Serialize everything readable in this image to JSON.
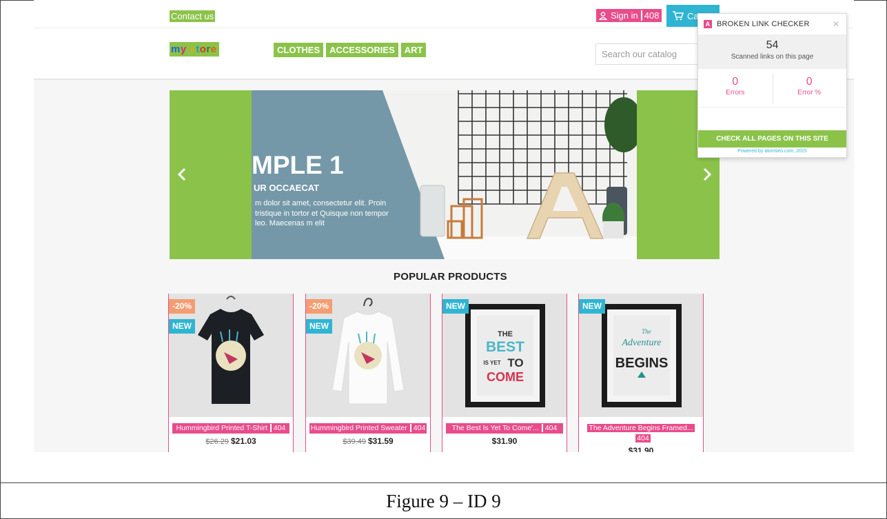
{
  "header": {
    "contact_label": "Contact us",
    "signin_label": "Sign in",
    "signin_badge": "408",
    "cart_label": "Cart",
    "logo_text": "my store",
    "nav": [
      "CLOTHES",
      "ACCESSORIES",
      "ART"
    ],
    "search_placeholder": "Search our catalog"
  },
  "slider": {
    "title": "MPLE 1",
    "subtitle": "UR OCCAECAT",
    "description": "m dolor sit amet, consectetur elit. Proin tristique in tortor et Quisque non tempor leo. Maecenas m elit",
    "prev_icon": "chevron-left-icon",
    "next_icon": "chevron-right-icon",
    "accent_color": "#8bc34a"
  },
  "section_title": "POPULAR PRODUCTS",
  "products": [
    {
      "name": "Hummingbird Printed T-Shirt",
      "badge": "404",
      "old_price": "$26.29",
      "price": "$21.03",
      "discount": "-20%",
      "flag": "NEW"
    },
    {
      "name": "Hummingbird Printed Sweater",
      "badge": "404",
      "old_price": "$39.49",
      "price": "$31.59",
      "discount": "-20%",
      "flag": "NEW"
    },
    {
      "name": "The Best Is Yet To Come'...",
      "badge": "404",
      "old_price": "",
      "price": "$31.90",
      "discount": "",
      "flag": "NEW"
    },
    {
      "name": "The Adventure Begins Framed...",
      "badge": "404",
      "old_price": "",
      "price": "$31.90",
      "discount": "",
      "flag": "NEW"
    }
  ],
  "broken_link_checker": {
    "title": "BROKEN LINK CHECKER",
    "logo_letter": "A",
    "scanned_count": "54",
    "scanned_label": "Scanned links on this page",
    "errors_value": "0",
    "errors_label": "Errors",
    "error_pct_value": "0",
    "error_pct_label": "Error %",
    "check_all_label": "CHECK ALL PAGES ON THIS SITE",
    "powered_by": "Powered by atomseo.com, 2015"
  },
  "poster_text": {
    "best_1": "THE",
    "best_2": "BEST",
    "best_3": "IS YET",
    "best_4": "TO",
    "best_5": "COME",
    "adv_1": "The",
    "adv_2": "Adventure",
    "adv_3": "BEGINS"
  },
  "caption": "Figure 9 – ID 9",
  "colors": {
    "brand_green": "#8bc34a",
    "link_error_pink": "#e84c8b",
    "cart_blue": "#2fb5d2",
    "discount_orange": "#f39d72"
  }
}
